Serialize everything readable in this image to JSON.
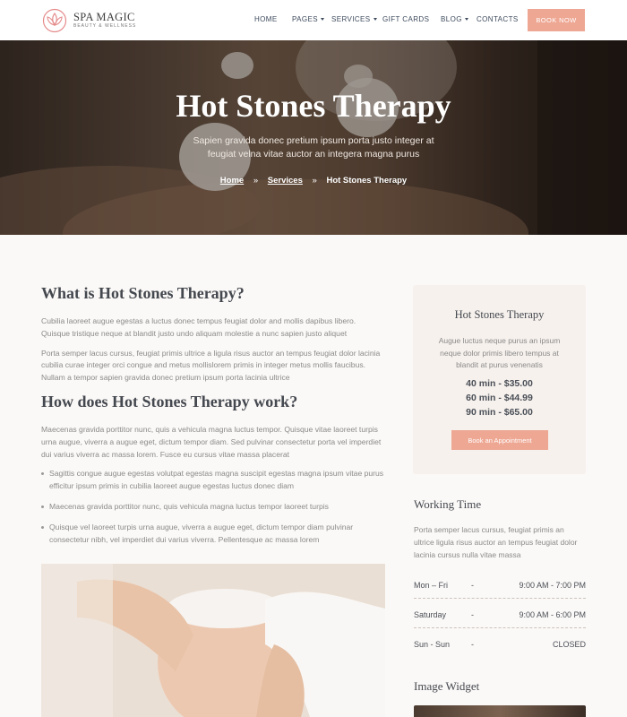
{
  "brand": {
    "name": "SPA MAGIC",
    "tagline": "BEAUTY & WELLNESS",
    "accent": "#eea793",
    "heading_color": "#44484f"
  },
  "nav": {
    "items": [
      {
        "label": "HOME",
        "dropdown": false
      },
      {
        "label": "PAGES",
        "dropdown": true
      },
      {
        "label": "SERVICES",
        "dropdown": true
      },
      {
        "label": "GIFT CARDS",
        "dropdown": false
      },
      {
        "label": "BLOG",
        "dropdown": true
      },
      {
        "label": "CONTACTS",
        "dropdown": false
      }
    ],
    "book_now": "BOOK NOW"
  },
  "hero": {
    "title": "Hot Stones Therapy",
    "subtitle": "Sapien gravida donec pretium ipsum porta justo integer at feugiat velna vitae auctor an integera magna purus",
    "breadcrumb": {
      "home": "Home",
      "services": "Services",
      "separator": "»",
      "current": "Hot Stones Therapy"
    }
  },
  "content": {
    "h1": "What is Hot Stones Therapy?",
    "p1": "Cubilia laoreet augue egestas a luctus donec tempus feugiat dolor and mollis dapibus libero. Quisque tristique neque at blandit justo undo aliquam molestie a nunc sapien justo aliquet",
    "p2": "Porta semper lacus cursus, feugiat primis ultrice a ligula risus auctor an tempus feugiat dolor lacinia cubilia curae integer orci congue and metus mollislorem primis in integer metus mollis faucibus. Nullam a tempor sapien gravida donec pretium ipsum porta lacinia ultrice",
    "h2": "How does Hot Stones Therapy work?",
    "p3": "Maecenas gravida porttitor nunc, quis a vehicula magna luctus tempor. Quisque vitae laoreet turpis urna augue, viverra a augue eget, dictum tempor diam. Sed pulvinar consectetur porta vel imperdiet dui varius viverra ac massa lorem. Fusce eu cursus vitae massa placerat",
    "bullets": [
      "Sagittis congue augue egestas volutpat egestas magna suscipit egestas magna ipsum vitae purus efficitur ipsum primis in cubilia laoreet augue egestas luctus donec diam",
      "Maecenas gravida porttitor nunc, quis vehicula magna luctus tempor laoreet turpis",
      "Quisque vel laoreet turpis urna augue, viverra a augue eget, dictum tempor diam pulvinar consectetur nibh, vel imperdiet dui varius viverra. Pellentesque ac massa lorem"
    ]
  },
  "sidebar": {
    "card": {
      "title": "Hot Stones Therapy",
      "text": "Augue luctus neque purus an ipsum neque dolor primis libero tempus at blandit at purus venenatis",
      "prices": [
        "40 min - $35.00",
        "60 min - $44.99",
        "90 min - $65.00"
      ],
      "button": "Book an Appointment"
    },
    "working": {
      "title": "Working Time",
      "text": "Porta semper lacus cursus, feugiat primis an ultrice ligula risus auctor an tempus feugiat dolor lacinia cursus nulla vitae massa",
      "rows": [
        {
          "day": "Mon – Fri",
          "sep": "-",
          "time": "9:00 AM - 7:00 PM"
        },
        {
          "day": "Saturday",
          "sep": "-",
          "time": "9:00 AM - 6:00 PM"
        },
        {
          "day": "Sun - Sun",
          "sep": "-",
          "time": "CLOSED"
        }
      ]
    },
    "image_widget_title": "Image Widget"
  }
}
